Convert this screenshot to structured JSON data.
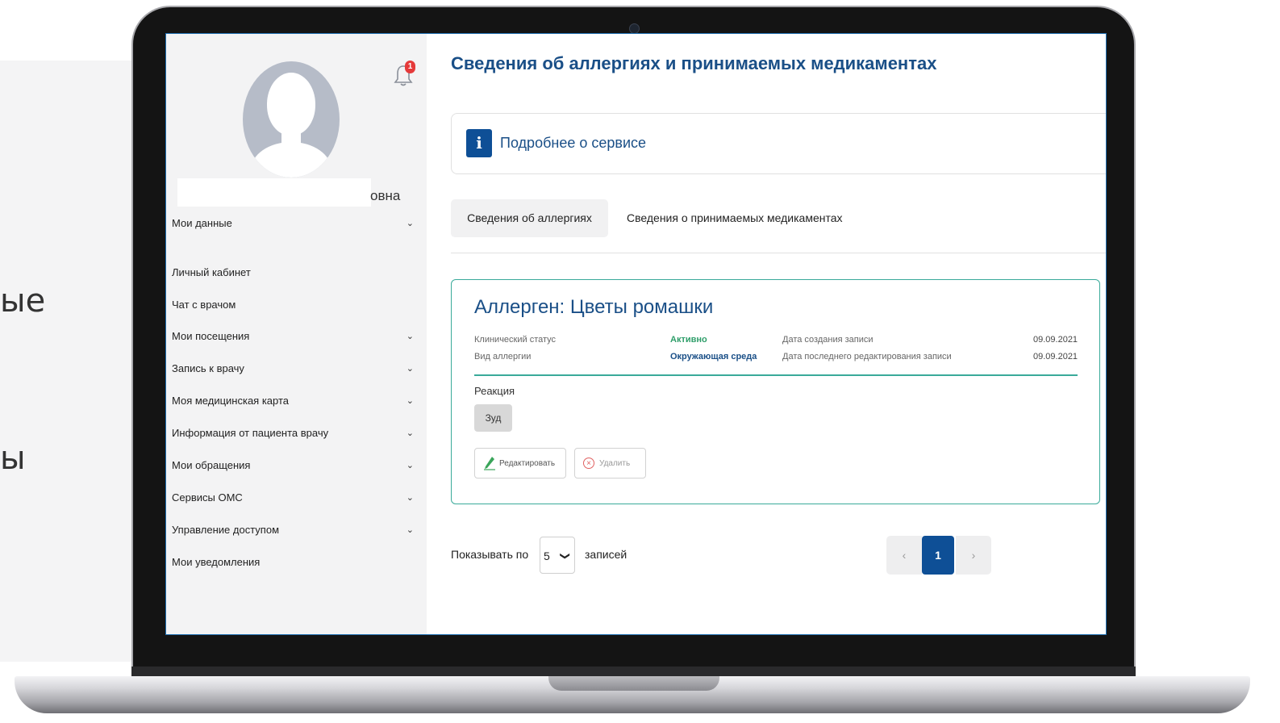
{
  "background": {
    "text_1": "ые",
    "text_2": "ы"
  },
  "sidebar": {
    "name_tail": "овна",
    "notification_count": "1",
    "items": [
      {
        "label": "Мои данные",
        "chevron": "⌄"
      },
      {
        "label": "Личный кабинет"
      },
      {
        "label": "Чат с врачом"
      },
      {
        "label": "Мои посещения",
        "chevron": "⌄"
      },
      {
        "label": "Запись к врачу",
        "chevron": "⌄"
      },
      {
        "label": "Моя медицинская карта",
        "chevron": "⌄"
      },
      {
        "label": "Информация от пациента врачу",
        "chevron": "⌄"
      },
      {
        "label": "Мои обращения",
        "chevron": "⌄"
      },
      {
        "label": "Сервисы ОМС",
        "chevron": "⌄"
      },
      {
        "label": "Управление доступом",
        "chevron": "⌄"
      },
      {
        "label": "Мои уведомления"
      }
    ]
  },
  "main": {
    "title": "Сведения об аллергиях и принимаемых медикаментах",
    "info": {
      "icon": "i",
      "link": "Подробнее о сервисе"
    },
    "tabs": [
      {
        "label": "Сведения об аллергиях",
        "active": true
      },
      {
        "label": "Сведения о принимаемых медикаментах",
        "active": false
      }
    ],
    "card": {
      "title": "Аллерген: Цветы ромашки",
      "clinical_status_label": "Клинический статус",
      "clinical_status_value": "Активно",
      "allergy_type_label": "Вид аллергии",
      "allergy_type_value": "Окружающая среда",
      "created_label": "Дата создания записи",
      "created_value": "09.09.2021",
      "edited_label": "Дата последнего редактирования записи",
      "edited_value": "09.09.2021",
      "reaction_label": "Реакция",
      "reaction_chip": "Зуд",
      "edit_button": "Редактировать",
      "delete_button": "Удалить"
    },
    "pager": {
      "show_label": "Показывать по",
      "page_size": "5",
      "records_label": "записей",
      "prev": "‹",
      "current_page": "1",
      "next": "›"
    }
  },
  "colors": {
    "accent": "#1a4f87",
    "primary_button": "#0e4f96",
    "card_border": "#3aaa9a",
    "status_green": "#2f9e6a",
    "badge_red": "#e53a3a"
  }
}
